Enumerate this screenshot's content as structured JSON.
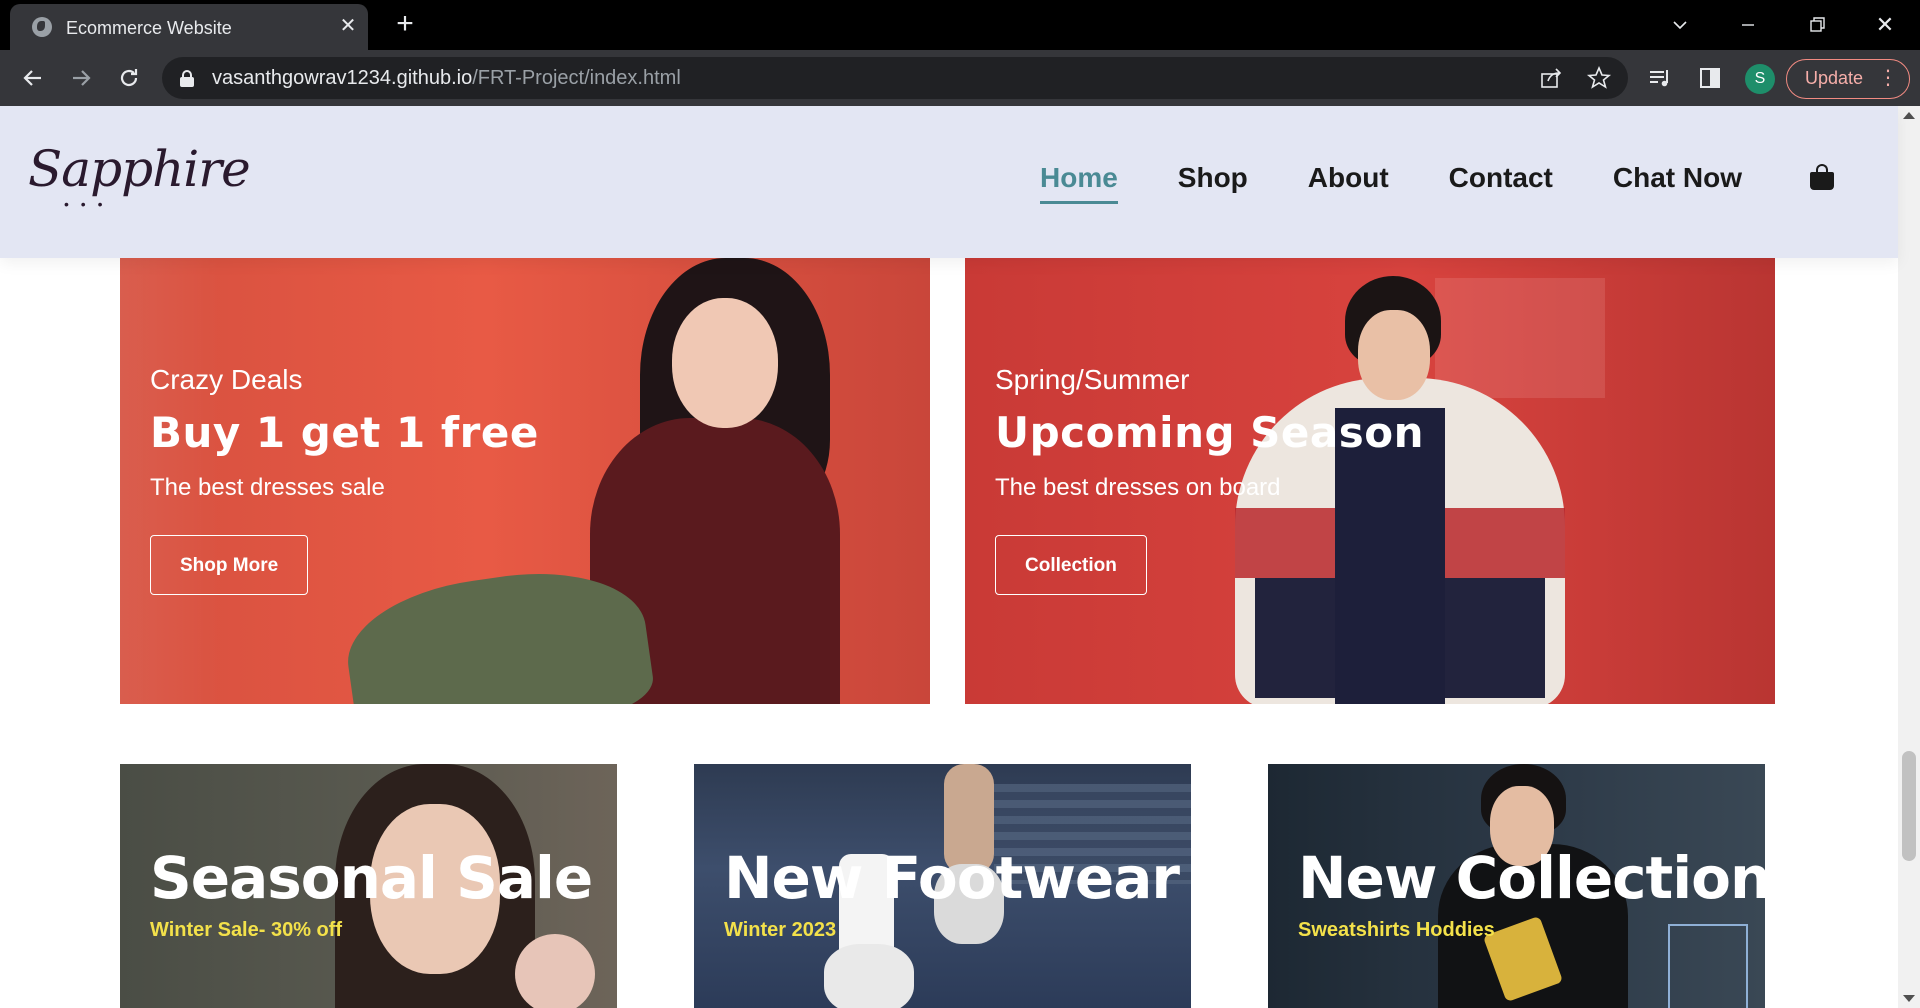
{
  "browser": {
    "tab_title": "Ecommerce Website",
    "url_domain": "vasanthgowrav1234.github.io",
    "url_path": "/FRT-Project/index.html",
    "profile_initial": "S",
    "update_label": "Update"
  },
  "header": {
    "logo_text": "Sapphire",
    "logo_dots": "• • •",
    "nav": [
      {
        "label": "Home",
        "active": true
      },
      {
        "label": "Shop",
        "active": false
      },
      {
        "label": "About",
        "active": false
      },
      {
        "label": "Contact",
        "active": false
      },
      {
        "label": "Chat Now",
        "active": false
      }
    ],
    "accent_color": "#4a8a94"
  },
  "banners_large": [
    {
      "subtitle": "Crazy Deals",
      "title": "Buy 1 get 1 free",
      "description": "The best dresses sale",
      "button_label": "Shop More"
    },
    {
      "subtitle": "Spring/Summer",
      "title": "Upcoming Season",
      "description": "The best dresses on board",
      "button_label": "Collection"
    }
  ],
  "banners_small": [
    {
      "title": "Seasonal Sale",
      "subtitle": "Winter Sale- 30% off"
    },
    {
      "title": "New Footwear",
      "subtitle": "Winter 2023"
    },
    {
      "title": "New Collection",
      "subtitle": "Sweatshirts Hoddies"
    }
  ],
  "colors": {
    "header_bg": "#e3e6f3",
    "subtitle_yellow": "#f3e14a",
    "banner_red": "#d6503f"
  }
}
